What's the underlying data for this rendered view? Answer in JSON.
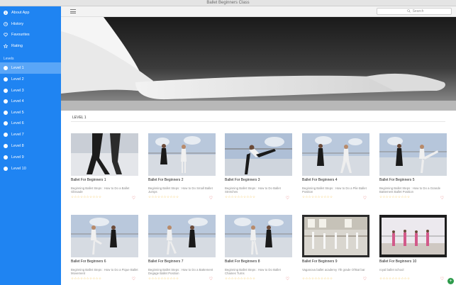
{
  "window": {
    "title": "Ballet Beginners Class"
  },
  "sidebar": {
    "top_items": [
      {
        "label": "About App",
        "icon": "info-icon"
      },
      {
        "label": "History",
        "icon": "clock-icon"
      },
      {
        "label": "Favourites",
        "icon": "heart-icon"
      },
      {
        "label": "Rating",
        "icon": "star-icon"
      }
    ],
    "section_label": "Levels",
    "levels": [
      {
        "label": "Level 1",
        "active": true
      },
      {
        "label": "Level 2"
      },
      {
        "label": "Level 3"
      },
      {
        "label": "Level 4"
      },
      {
        "label": "Level 5"
      },
      {
        "label": "Level 6"
      },
      {
        "label": "Level 7"
      },
      {
        "label": "Level 8"
      },
      {
        "label": "Level 9"
      },
      {
        "label": "Level 10"
      }
    ]
  },
  "toolbar": {
    "search_placeholder": "Search"
  },
  "content": {
    "section_title": "LEVEL 1",
    "videos": [
      {
        "title": "Ballet For Beginners 1",
        "desc": "Beginning Ballet Steps : How to Do a Ballet Glissade"
      },
      {
        "title": "Ballet For Beginners 2",
        "desc": "Beginning Ballet Steps : How to Do Small Ballet Jumps"
      },
      {
        "title": "Ballet For Beginners 3",
        "desc": "Beginning Ballet Steps : How to Do Ballet Stretches"
      },
      {
        "title": "Ballet For Beginners 4",
        "desc": "Beginning Ballet Steps : How to Do a Plie Ballet Position"
      },
      {
        "title": "Ballet For Beginners 5",
        "desc": "Beginning Ballet Steps : How to Do a Grande Battement Ballet Position"
      },
      {
        "title": "Ballet For Beginners 6",
        "desc": "Beginning Ballet Steps : How to Do a Pique Ballet Movement"
      },
      {
        "title": "Ballet For Beginners 7",
        "desc": "Beginning Ballet Steps : How to Do a Battement Degage Ballet Position"
      },
      {
        "title": "Ballet For Beginners 8",
        "desc": "Beginning Ballet Steps : How to Do Ballet Chaines Turns"
      },
      {
        "title": "Ballet For Beginners 9",
        "desc": "Vaganova ballet academy 7th grade Ol'Bat bar"
      },
      {
        "title": "Ballet For Beginners 10",
        "desc": "royal ballet school"
      }
    ],
    "rating_stars": "☆☆☆☆☆☆☆☆☆☆",
    "heart_glyph": "♡"
  },
  "fab": {
    "glyph": "+"
  }
}
